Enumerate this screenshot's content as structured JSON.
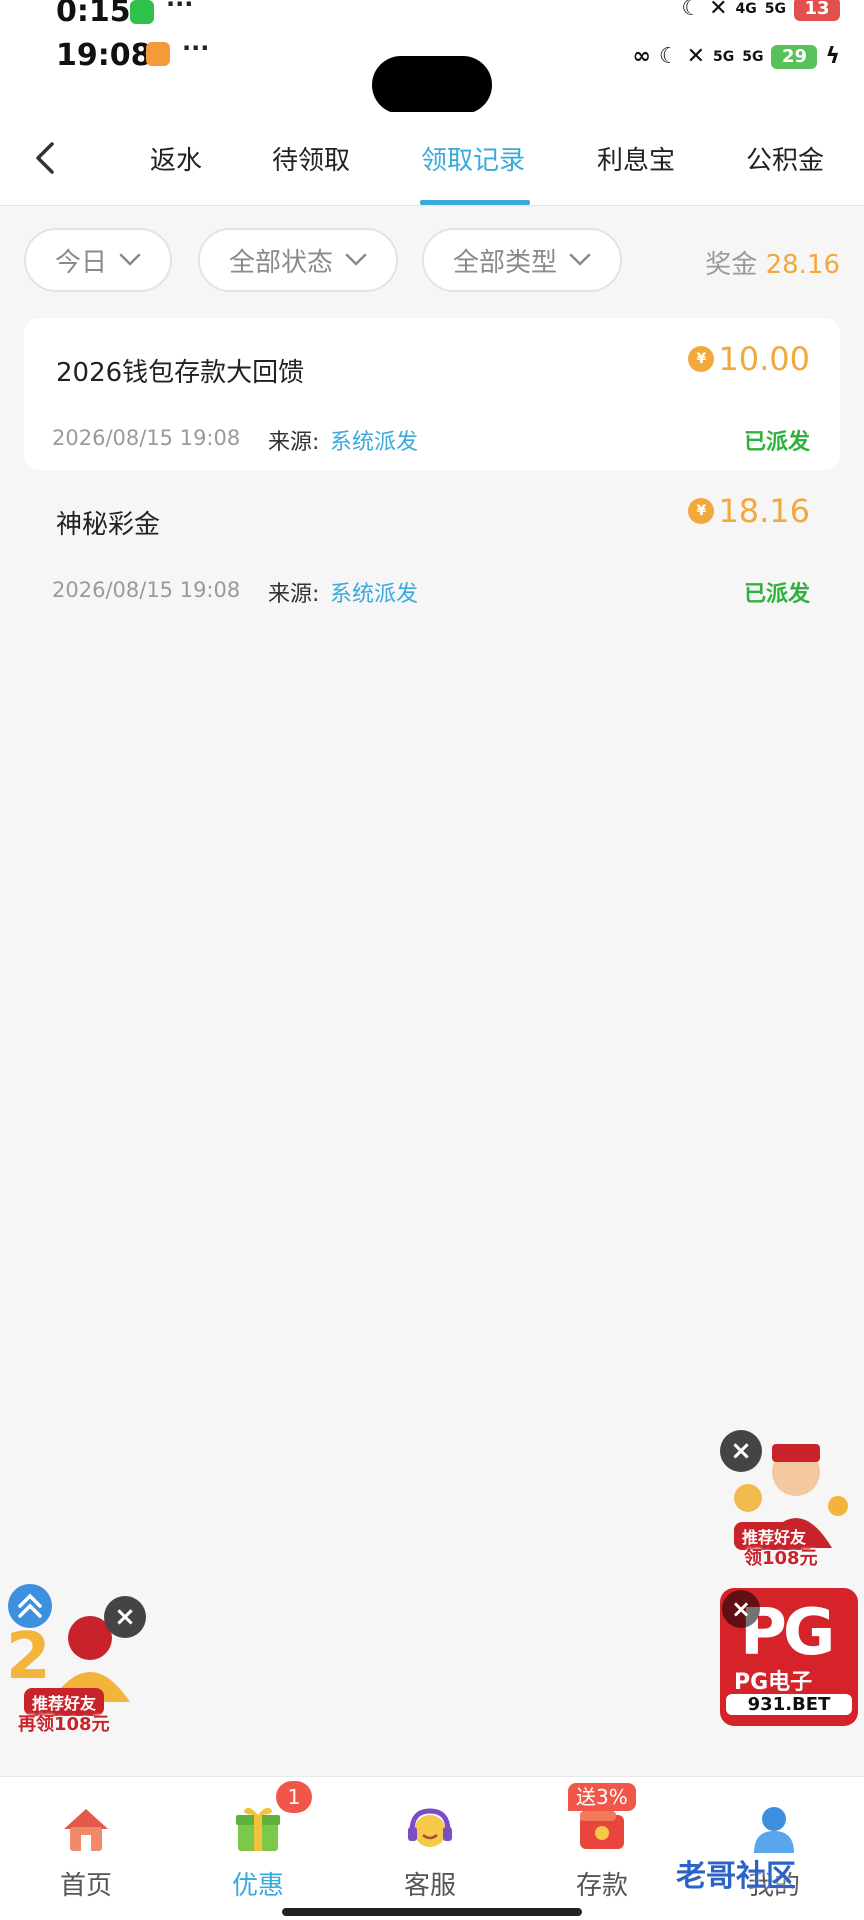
{
  "status_bar_top": {
    "time": "0:15",
    "network_1": "4G",
    "network_2": "5G",
    "battery": "13"
  },
  "status_bar_main": {
    "time": "19:08",
    "network_1": "5G",
    "network_2": "5G",
    "battery": "29"
  },
  "tabs": [
    {
      "label": "返水"
    },
    {
      "label": "待领取"
    },
    {
      "label": "领取记录"
    },
    {
      "label": "利息宝"
    },
    {
      "label": "公积金"
    }
  ],
  "filters": {
    "date": "今日",
    "status": "全部状态",
    "type": "全部类型"
  },
  "bonus": {
    "label": "奖金",
    "value": "28.16"
  },
  "records": [
    {
      "title": "2026钱包存款大回馈",
      "amount": "10.00",
      "date": "2026/08/15 19:08",
      "source_label": "来源:",
      "source": "系统派发",
      "status": "已派发"
    },
    {
      "title": "神秘彩金",
      "amount": "18.16",
      "date": "2026/08/15 19:08",
      "source_label": "来源:",
      "source": "系统派发",
      "status": "已派发"
    }
  ],
  "currency_symbol": "¥",
  "promos": {
    "right_top": {
      "tag": "推荐好友",
      "sub": "领108元"
    },
    "left": {
      "tag": "推荐好友",
      "sub": "再领108元"
    },
    "pg": {
      "big": "PG",
      "label": "PG电子",
      "site": "931.BET"
    }
  },
  "bottom_nav": [
    {
      "label": "首页",
      "icon": "home-icon"
    },
    {
      "label": "优惠",
      "icon": "gift-icon",
      "badge": "1"
    },
    {
      "label": "客服",
      "icon": "headset-icon"
    },
    {
      "label": "存款",
      "icon": "wallet-icon",
      "badge": "送3%"
    },
    {
      "label": "我的",
      "icon": "user-icon"
    }
  ],
  "watermark": "老哥社区",
  "colors": {
    "accent": "#3aa9dc",
    "amount": "#f2a93b",
    "status_ok": "#2db33c",
    "badge": "#f2564a"
  }
}
